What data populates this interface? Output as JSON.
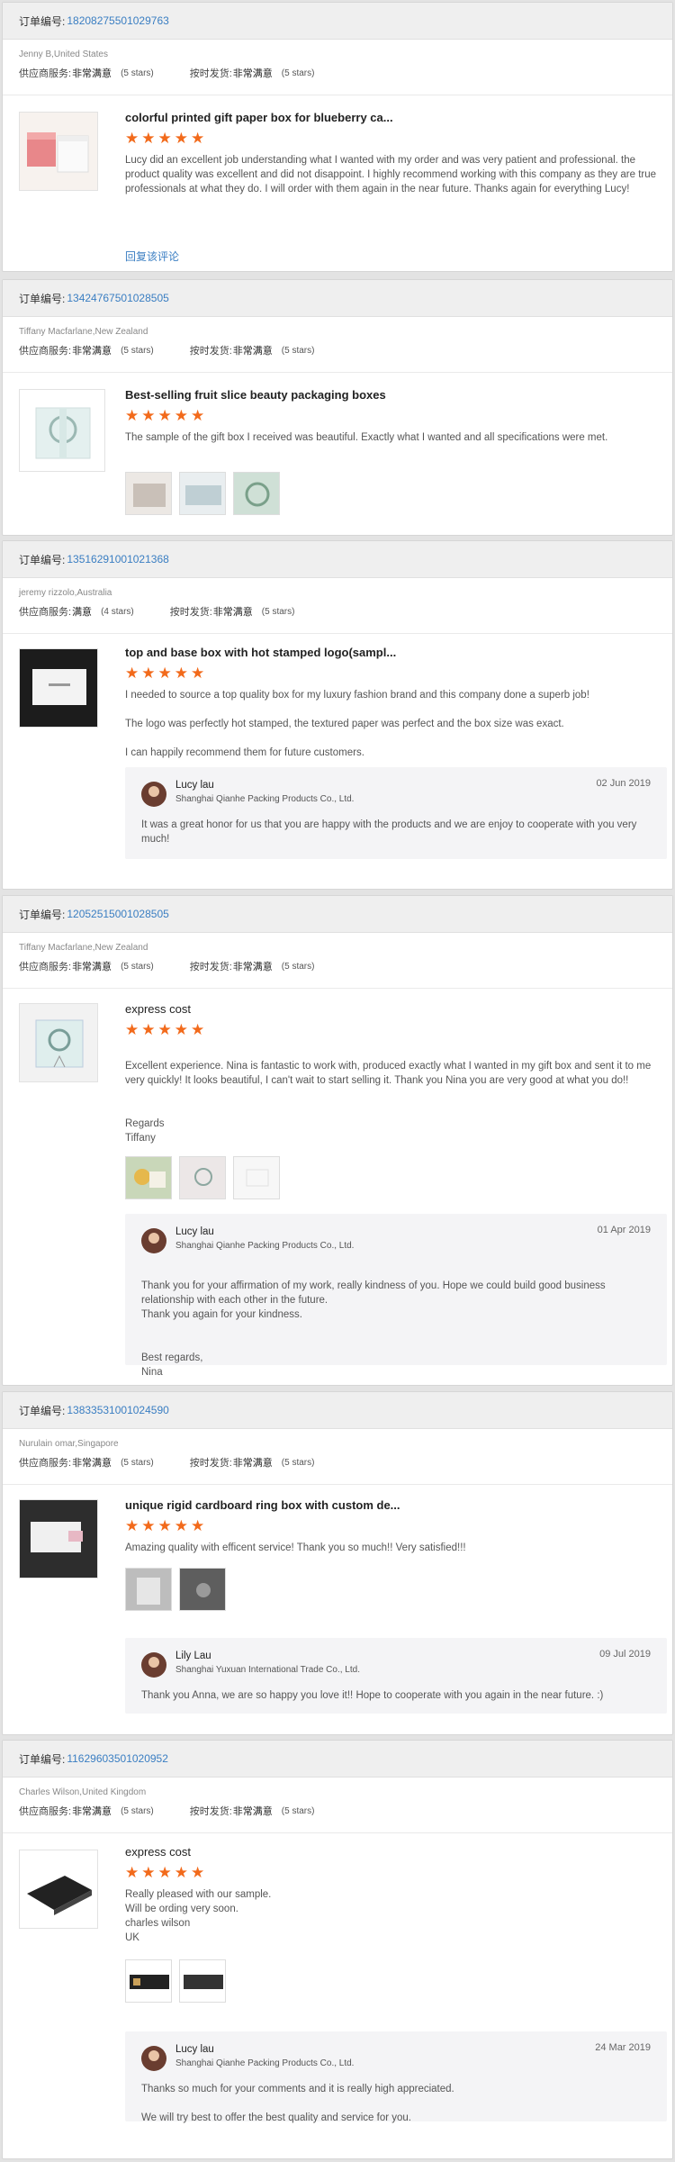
{
  "labels": {
    "order_no": "订单编号:",
    "supplier_service": "供应商服务:",
    "on_time": "按时发货:",
    "reply_review": "回复该评论"
  },
  "reviews": [
    {
      "order_no": "18208275501029763",
      "buyer": "Jenny B,United States",
      "supplier_score": "非常满意",
      "supplier_stars": "(5 stars)",
      "ontime_score": "非常满意",
      "ontime_stars": "(5 stars)",
      "product_title": "colorful printed gift paper box for blueberry ca...",
      "rating": 5,
      "text": [
        "Lucy did an excellent job understanding what I wanted with my order and was very patient and professional. the product quality was excellent and did not disappoint. I highly recommend working with this company as they are true professionals at what they do. I will order with them again in the near future. Thanks again for everything Lucy!"
      ],
      "has_reply_link": true
    },
    {
      "order_no": "13424767501028505",
      "buyer": "Tiffany Macfarlane,New Zealand",
      "supplier_score": "非常满意",
      "supplier_stars": "(5 stars)",
      "ontime_score": "非常满意",
      "ontime_stars": "(5 stars)",
      "product_title": "Best-selling fruit slice beauty packaging boxes",
      "rating": 5,
      "text": [
        "The sample of the gift box I received was beautiful.  Exactly what I wanted and all specifications were met."
      ]
    },
    {
      "order_no": "13516291001021368",
      "buyer": "jeremy rizzolo,Australia",
      "supplier_score": "满意",
      "supplier_stars": "(4 stars)",
      "ontime_score": "非常满意",
      "ontime_stars": "(5 stars)",
      "product_title": "top and base box with hot stamped logo(sampl...",
      "rating": 5,
      "text": [
        "I needed to source a top quality box for my luxury fashion brand and this company done a superb job!",
        "The logo was perfectly hot stamped, the textured paper was perfect and the box size was exact.",
        "I can happily recommend them for future customers."
      ],
      "reply": {
        "name": "Lucy lau",
        "company": "Shanghai Qianhe Packing Products Co., Ltd.",
        "date": "02 Jun 2019",
        "text": [
          "It was a great honor for us that you are happy with the products and we are enjoy to cooperate with you very much!"
        ]
      }
    },
    {
      "order_no": "12052515001028505",
      "buyer": "Tiffany Macfarlane,New Zealand",
      "supplier_score": "非常满意",
      "supplier_stars": "(5 stars)",
      "ontime_score": "非常满意",
      "ontime_stars": "(5 stars)",
      "product_title": "express cost",
      "rating": 5,
      "text": [
        "Excellent experience.  Nina is fantastic to work with, produced exactly what I wanted in my gift box and sent it to me very quickly! It looks beautiful, I can't wait to start selling it. Thank you Nina you are very good at what you do!!",
        "Regards\nTiffany"
      ],
      "reply": {
        "name": "Lucy lau",
        "company": "Shanghai Qianhe Packing Products Co., Ltd.",
        "date": "01 Apr 2019",
        "text": [
          "Thank you for your affirmation of my work, really kindness of you. Hope we could build good business relationship with each other in the future.\nThank you again for your kindness.",
          "Best regards,\nNina"
        ]
      }
    },
    {
      "order_no": "13833531001024590",
      "buyer": "Nurulain omar,Singapore",
      "supplier_score": "非常满意",
      "supplier_stars": "(5 stars)",
      "ontime_score": "非常满意",
      "ontime_stars": "(5 stars)",
      "product_title": "unique rigid cardboard ring box with custom de...",
      "rating": 5,
      "text": [
        "Amazing quality with efficent service! Thank you so much!! Very satisfied!!!"
      ],
      "reply": {
        "name": "Lily Lau",
        "company": "Shanghai Yuxuan International Trade Co., Ltd.",
        "date": "09 Jul 2019",
        "text": [
          "Thank you Anna, we are so happy you love it!! Hope to cooperate with you again in the near future. :)"
        ]
      }
    },
    {
      "order_no": "11629603501020952",
      "buyer": "Charles Wilson,United Kingdom",
      "supplier_score": "非常满意",
      "supplier_stars": "(5 stars)",
      "ontime_score": "非常满意",
      "ontime_stars": "(5 stars)",
      "product_title": "express cost",
      "rating": 5,
      "text": [
        "Really pleased with our sample.\nWill be ording very soon.\ncharles wilson\nUK"
      ],
      "reply": {
        "name": "Lucy lau",
        "company": "Shanghai Qianhe Packing Products Co., Ltd.",
        "date": "24 Mar 2019",
        "text": [
          "Thanks so much for your comments and it is really high appreciated.",
          "We will try best to offer the best quality and service for you."
        ]
      }
    }
  ]
}
